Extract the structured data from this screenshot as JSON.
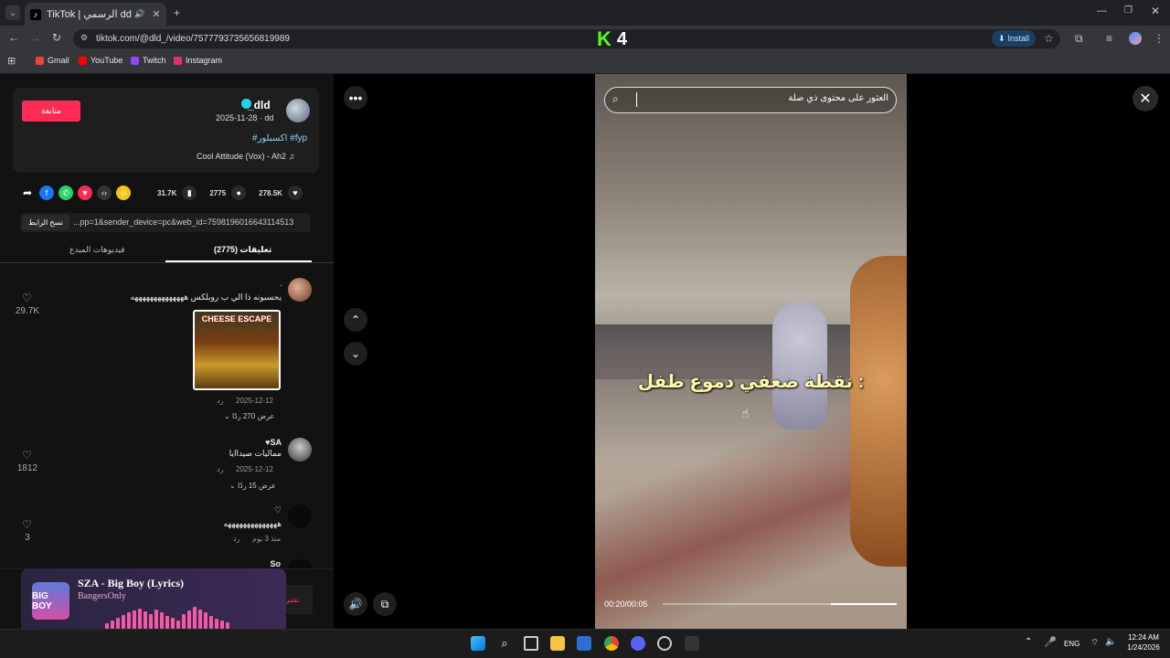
{
  "browser": {
    "tab_title": "TikTok | الرسمي dd (@dld_)",
    "url": "tiktok.com/@dld_/video/7577793735656819989",
    "install_label": "Install",
    "bookmarks": [
      {
        "label": "Gmail",
        "color": "#ea4335"
      },
      {
        "label": "YouTube",
        "color": "#ff0000"
      },
      {
        "label": "Twitch",
        "color": "#9146ff"
      },
      {
        "label": "Instagram",
        "color": "#e1306c"
      }
    ]
  },
  "watermark": {
    "text": "4"
  },
  "video_info": {
    "follow_label": "متابعة",
    "username": "_dld",
    "date_line": "2025-11-28 · dd",
    "hashtags": "#اكسبلور #fyp",
    "song": "Cool Attitude (Vox) - Ah2",
    "likes": "278.5K",
    "comments": "2775",
    "saves": "31.7K",
    "copy_link_label": "نسخ الرابط",
    "link_text": "...pp=1&sender_device=pc&web_id=7598196016643114513"
  },
  "tabs": {
    "comments_label": "(2775) تعليقات",
    "creator_videos_label": "فيديوهات المبدع"
  },
  "comments": [
    {
      "name": ".",
      "text": "يحسبونه ذا الي ب روبلكس ههههههههههههههه",
      "image_title": "CHEESE ESCAPE",
      "date": "2025-12-12",
      "reply_label": "رد",
      "view_replies": "عرض 270 ردًا",
      "likes": "29.7K"
    },
    {
      "name": "SA",
      "text": "ممالیات صیداایا",
      "date": "2025-12-12",
      "reply_label": "رد",
      "view_replies": "عرض 15 ردًا",
      "likes": "1812"
    },
    {
      "name": "♡",
      "text": "ههههههههههههههه",
      "date": "منذ 3 يوم",
      "reply_label": "رد",
      "likes": "3"
    },
    {
      "name": "So"
    }
  ],
  "comment_box": {
    "post_label": "نشر"
  },
  "player": {
    "search_placeholder": "العثور على محتوى ذي صلة",
    "overlay_text": "نقطة ضعفي دموع طفل :",
    "timecode": "00:20/00:05",
    "progress": 0.72
  },
  "now_playing": {
    "title": "SZA - Big Boy (Lyrics)",
    "artist": "BangersOnly",
    "art_label": "BIG BOY"
  },
  "taskbar": {
    "lang": "ENG",
    "time": "12:24 AM",
    "date": "1/24/2026"
  }
}
